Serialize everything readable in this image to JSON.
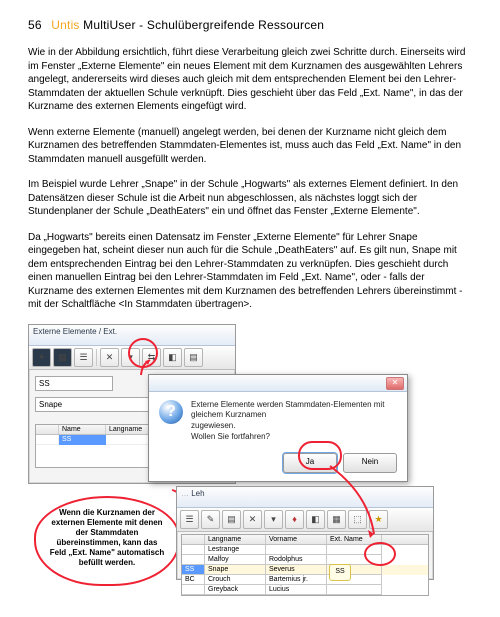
{
  "header": {
    "page_number": "56",
    "brand": "Untis",
    "title_rest": " MultiUser - Schulübergreifende Ressourcen"
  },
  "paragraphs": {
    "p1": "Wie in der Abbildung ersichtlich, führt diese Verarbeitung gleich zwei Schritte durch. Einerseits wird im Fenster „Externe Elemente\" ein neues Element mit dem Kurznamen des ausgewählten Lehrers angelegt, andererseits wird dieses auch gleich mit dem entsprechenden Element bei den Lehrer-Stammdaten der aktuellen Schule verknüpft. Dies geschieht über das Feld „Ext. Name\", in das der Kurzname des externen Elements eingefügt wird.",
    "p2": "Wenn externe Elemente (manuell) angelegt werden, bei denen der Kurzname nicht gleich dem Kurznamen des betreffenden Stammdaten-Elementes ist, muss auch das Feld „Ext. Name\" in den Stammdaten manuell ausgefüllt werden.",
    "p3": "Im Beispiel wurde Lehrer „Snape\" in der Schule „Hogwarts\" als externes Element definiert. In den Datensätzen dieser Schule ist die Arbeit nun abgeschlossen, als nächstes loggt sich der Stundenplaner der Schule „DeathEaters\" ein und öffnet das Fenster „Externe Elemente\".",
    "p4": "Da „Hogwarts\" bereits einen Datensatz im Fenster „Externe Elemente\" für Lehrer Snape eingegeben hat, scheint dieser nun auch für die Schule „DeathEaters\" auf. Es gilt nun, Snape mit dem entsprechenden Eintrag bei den Lehrer-Stammdaten zu verknüpfen. Dies geschieht durch einen manuellen Eintrag bei den Lehrer-Stammdaten im Feld „Ext. Name\", oder - falls der Kurzname des externen Elementes mit dem Kurznamen des betreffenden Lehrers übereinstimmt - mit der Schaltfläche <In Stammdaten übertragen>."
  },
  "fig": {
    "win1": {
      "title": "Externe Elemente / Ext.",
      "field1": "SS",
      "field2": "Snape",
      "grid": {
        "hdr": [
          "",
          "Name",
          "Langname"
        ],
        "row": [
          "",
          "SS",
          ""
        ]
      }
    },
    "dialog": {
      "line1": "Externe Elemente werden Stammdaten-Elementen mit gleichem Kurznamen",
      "line2": "zugewiesen.",
      "line3": "Wollen Sie fortfahren?",
      "btn_yes": "Ja",
      "btn_no": "Nein"
    },
    "callout": "Wenn die Kurznamen der externen Elemente mit denen der Stammdaten übereinstimmen, kann das Feld „Ext. Name\" automatisch befüllt werden.",
    "win2": {
      "title_suffix": "Leh",
      "hdr": [
        "",
        "Langname",
        "Vorname",
        "Ext. Name"
      ],
      "rows": [
        [
          "",
          "Lestrange",
          "",
          ""
        ],
        [
          "",
          "Malfoy",
          "Rodolphus",
          ""
        ],
        [
          "SS",
          "Snape",
          "Severus",
          "SS"
        ],
        [
          "BC",
          "Crouch",
          "Bartemius jr.",
          ""
        ],
        [
          "",
          "Greyback",
          "Lucius",
          ""
        ]
      ]
    }
  }
}
